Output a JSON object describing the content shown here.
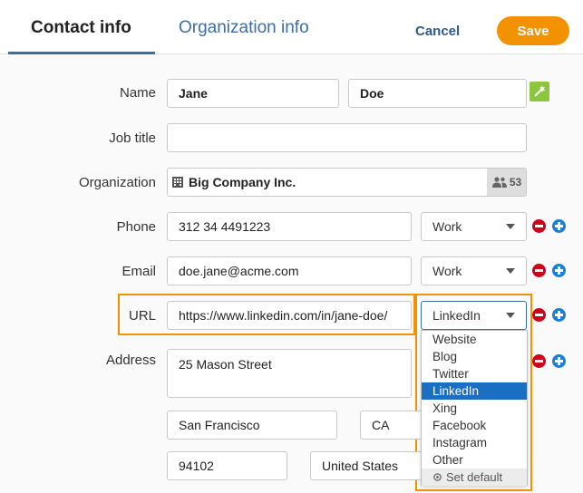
{
  "header": {
    "tabs": [
      {
        "label": "Contact info",
        "active": true
      },
      {
        "label": "Organization info",
        "active": false
      }
    ],
    "cancel_label": "Cancel",
    "save_label": "Save"
  },
  "form": {
    "name": {
      "label": "Name",
      "first": "Jane",
      "last": "Doe"
    },
    "job_title": {
      "label": "Job title",
      "value": ""
    },
    "organization": {
      "label": "Organization",
      "value": "Big Company Inc.",
      "count": "53"
    },
    "phone": {
      "label": "Phone",
      "value": "312 34 4491223",
      "type": "Work"
    },
    "email": {
      "label": "Email",
      "value": "doe.jane@acme.com",
      "type": "Work"
    },
    "url": {
      "label": "URL",
      "value": "https://www.linkedin.com/in/jane-doe/",
      "type": "LinkedIn"
    },
    "address": {
      "label": "Address",
      "street": "25 Mason Street",
      "city": "San Francisco",
      "state": "CA",
      "zip": "94102",
      "country": "United States"
    }
  },
  "url_type_dropdown": {
    "options": [
      "Website",
      "Blog",
      "Twitter",
      "LinkedIn",
      "Xing",
      "Facebook",
      "Instagram",
      "Other"
    ],
    "selected": "LinkedIn",
    "set_default_label": "Set default"
  },
  "colors": {
    "accent": "#f39200",
    "link": "#3b6ea5",
    "selected": "#1a6fc2",
    "remove": "#d0021b",
    "add": "#1a7fd6",
    "wand": "#8cc63f"
  },
  "icons": [
    "magic-wand-icon",
    "building-icon",
    "people-icon",
    "remove-icon",
    "add-icon",
    "gear-icon",
    "caret-down-icon"
  ]
}
